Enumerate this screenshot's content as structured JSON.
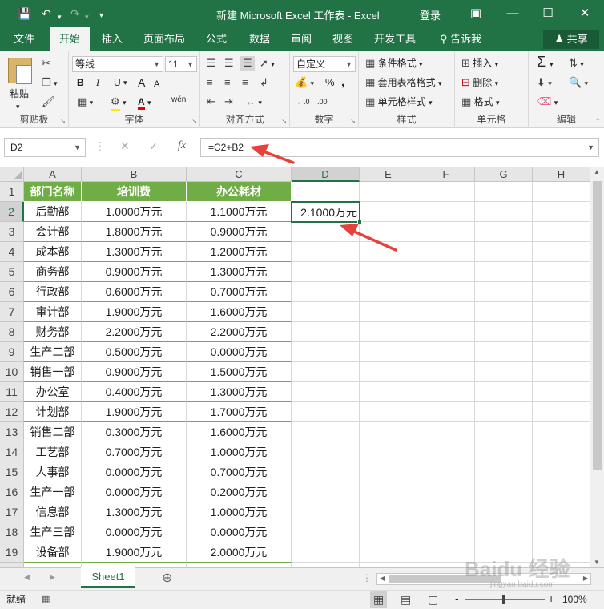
{
  "window": {
    "title": "新建 Microsoft Excel 工作表  -  Excel",
    "login": "登录",
    "qa_save_icon": "save-icon",
    "qa_undo_icon": "undo-icon",
    "qa_redo_icon": "redo-icon"
  },
  "tabs": [
    "文件",
    "开始",
    "插入",
    "页面布局",
    "公式",
    "数据",
    "审阅",
    "视图",
    "开发工具"
  ],
  "tell_me": "告诉我",
  "share": "共享",
  "ribbon": {
    "clipboard": {
      "paste": "粘贴",
      "label": "剪贴板"
    },
    "font": {
      "name": "等线",
      "size": "11",
      "bold": "B",
      "italic": "I",
      "underline": "U",
      "grow": "A",
      "shrink": "A",
      "wen": "wén",
      "label": "字体"
    },
    "align": {
      "label": "对齐方式"
    },
    "number": {
      "format": "自定义",
      "percent": "%",
      "comma": ",",
      "label": "数字"
    },
    "styles": {
      "cond": "条件格式",
      "table": "套用表格格式",
      "cell": "单元格样式",
      "label": "样式"
    },
    "cells": {
      "insert": "插入",
      "delete": "删除",
      "format": "格式",
      "label": "单元格"
    },
    "editing": {
      "label": "编辑"
    }
  },
  "formula_bar": {
    "name_box": "D2",
    "fx": "fx",
    "formula": "=C2+B2"
  },
  "columns": [
    "A",
    "B",
    "C",
    "D",
    "E",
    "F",
    "G",
    "H"
  ],
  "selected_column": "D",
  "selected_row": "2",
  "table": {
    "headers": [
      "部门名称",
      "培训费",
      "办公耗材"
    ],
    "rows": [
      [
        "后勤部",
        "1.0000万元",
        "1.1000万元"
      ],
      [
        "会计部",
        "1.8000万元",
        "0.9000万元"
      ],
      [
        "成本部",
        "1.3000万元",
        "1.2000万元"
      ],
      [
        "商务部",
        "0.9000万元",
        "1.3000万元"
      ],
      [
        "行政部",
        "0.6000万元",
        "0.7000万元"
      ],
      [
        "审计部",
        "1.9000万元",
        "1.6000万元"
      ],
      [
        "财务部",
        "2.2000万元",
        "2.2000万元"
      ],
      [
        "生产二部",
        "0.5000万元",
        "0.0000万元"
      ],
      [
        "销售一部",
        "0.9000万元",
        "1.5000万元"
      ],
      [
        "办公室",
        "0.4000万元",
        "1.3000万元"
      ],
      [
        "计划部",
        "1.9000万元",
        "1.7000万元"
      ],
      [
        "销售二部",
        "0.3000万元",
        "1.6000万元"
      ],
      [
        "工艺部",
        "0.7000万元",
        "1.0000万元"
      ],
      [
        "人事部",
        "0.0000万元",
        "0.7000万元"
      ],
      [
        "生产一部",
        "0.0000万元",
        "0.2000万元"
      ],
      [
        "信息部",
        "1.3000万元",
        "1.0000万元"
      ],
      [
        "生产三部",
        "0.0000万元",
        "0.0000万元"
      ],
      [
        "设备部",
        "1.9000万元",
        "2.0000万元"
      ]
    ]
  },
  "active_cell_value": "2.1000万元",
  "sheet_tab": "Sheet1",
  "status": {
    "ready": "就绪",
    "zoom": "100%",
    "zoom_minus": "-",
    "zoom_plus": "+"
  },
  "watermark": "Baidu 经验",
  "watermark_url": "jingyan.baidu.com",
  "colors": {
    "excel_green": "#217346",
    "header_fill": "#70ad47",
    "arrow": "#e8413a"
  }
}
